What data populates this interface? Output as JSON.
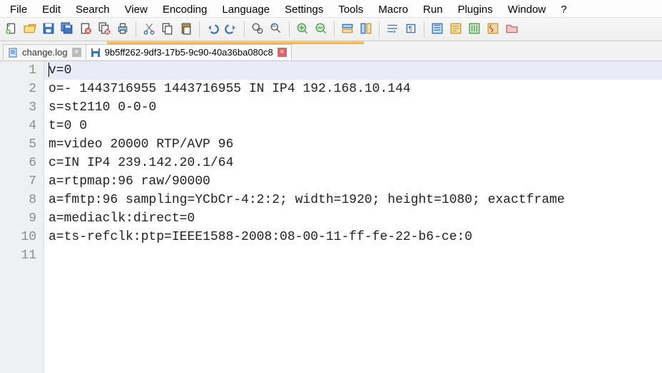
{
  "menu": {
    "items": [
      "File",
      "Edit",
      "Search",
      "View",
      "Encoding",
      "Language",
      "Settings",
      "Tools",
      "Macro",
      "Run",
      "Plugins",
      "Window",
      "?"
    ]
  },
  "toolbar": {
    "icons": [
      "new-doc",
      "open",
      "save",
      "save-all",
      "close",
      "close-all",
      "print",
      "|",
      "cut",
      "copy",
      "paste",
      "|",
      "undo",
      "redo",
      "|",
      "find",
      "replace",
      "|",
      "zoom-in",
      "zoom-out",
      "|",
      "sync-v",
      "sync-h",
      "|",
      "wrap",
      "show-all",
      "|",
      "indent-guide",
      "lang-color",
      "doc-map",
      "func-list",
      "folder"
    ]
  },
  "tabs": [
    {
      "label": "change.log",
      "icon": "doc-blue",
      "active": false
    },
    {
      "label": "9b5ff262-9df3-17b5-9c90-40a36ba080c8",
      "icon": "floppy-blue",
      "active": true
    }
  ],
  "editor": {
    "current_line": 1,
    "lines": [
      "v=0",
      "o=- 1443716955 1443716955 IN IP4 192.168.10.144",
      "s=st2110 0-0-0",
      "t=0 0",
      "m=video 20000 RTP/AVP 96",
      "c=IN IP4 239.142.20.1/64",
      "a=rtpmap:96 raw/90000",
      "a=fmtp:96 sampling=YCbCr-4:2:2; width=1920; height=1080; exactframe",
      "a=mediaclk:direct=0",
      "a=ts-refclk:ptp=IEEE1588-2008:08-00-11-ff-fe-22-b6-ce:0",
      ""
    ]
  }
}
